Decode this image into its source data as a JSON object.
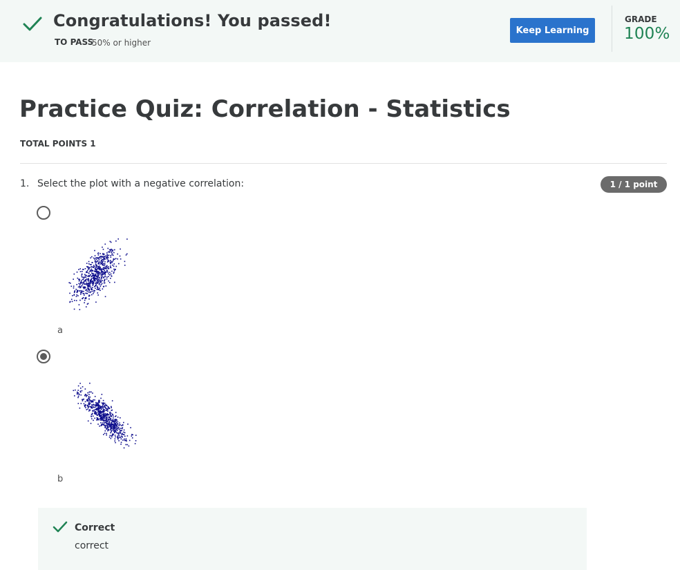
{
  "banner": {
    "title": "Congratulations! You passed!",
    "to_pass_label": "TO PASS",
    "to_pass_value": "50% or higher",
    "keep_learning_label": "Keep Learning",
    "grade_label": "GRADE",
    "grade_value": "100%"
  },
  "quiz": {
    "title": "Practice Quiz: Correlation - Statistics",
    "total_points": "TOTAL POINTS 1"
  },
  "question": {
    "number": "1.",
    "text": "Select the plot with a negative correlation:",
    "points_badge": "1 / 1 point",
    "options": [
      {
        "label": "a",
        "selected": false,
        "correlation": 0.6
      },
      {
        "label": "b",
        "selected": true,
        "correlation": -0.85
      }
    ]
  },
  "feedback": {
    "title": "Correct",
    "text": "correct"
  },
  "colors": {
    "banner_bg": "#f3f8f6",
    "success_green": "#1f8354",
    "primary_button": "#2a73cc",
    "scatter_dots": "#0d0d8c"
  },
  "icons": {
    "pass": "checkmark-icon",
    "feedback": "checkmark-icon"
  }
}
